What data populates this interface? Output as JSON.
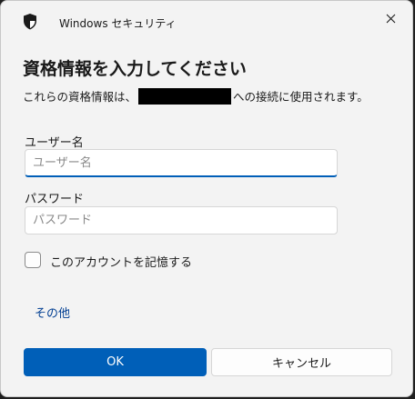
{
  "window": {
    "title": "Windows セキュリティ",
    "app_icon": "shield-icon",
    "close_icon": "close-icon"
  },
  "dialog": {
    "heading": "資格情報を入力してください",
    "description_prefix": "これらの資格情報は、",
    "description_suffix": "への接続に使用されます。"
  },
  "form": {
    "username_label": "ユーザー名",
    "username_placeholder": "ユーザー名",
    "password_label": "パスワード",
    "password_placeholder": "パスワード",
    "remember_label": "このアカウントを記憶する",
    "remember_checked": false
  },
  "more_options": "その他",
  "buttons": {
    "ok": "OK",
    "cancel": "キャンセル"
  },
  "colors": {
    "accent": "#005fb8",
    "link": "#003e92",
    "background": "#f3f3f3"
  }
}
